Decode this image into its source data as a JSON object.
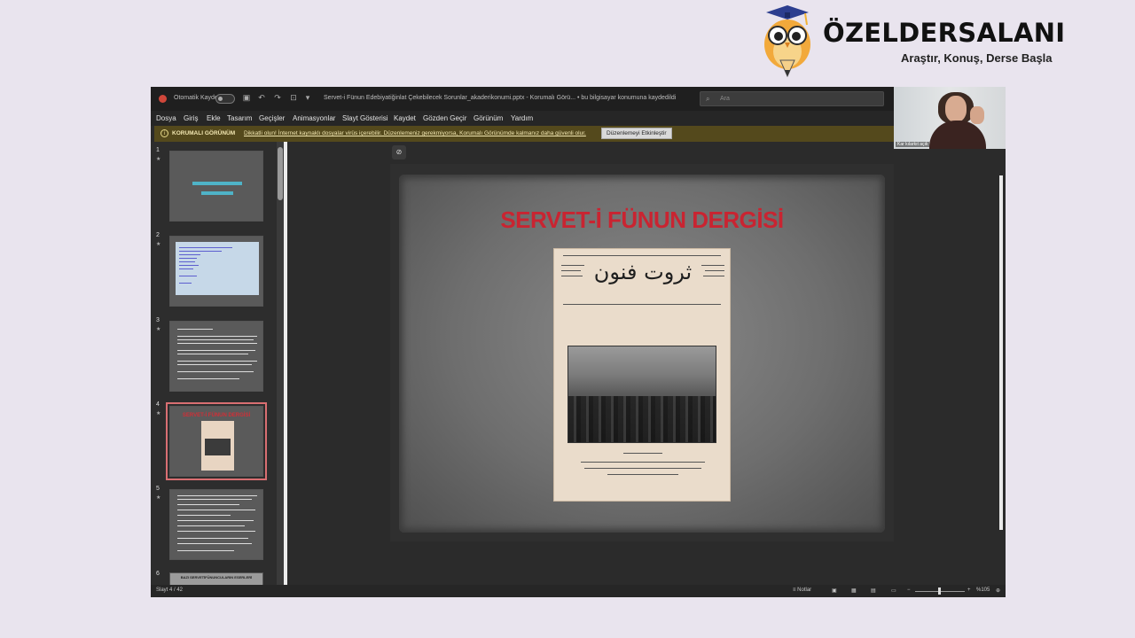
{
  "brand": {
    "name": "ÖZELDERSALANI",
    "tagline": "Araştır, Konuş, Derse Başla"
  },
  "titlebar": {
    "autosave_label": "Otomatik Kaydet",
    "document_title": "Servet-i Fünun Edebiyatiğinlat Çekebilecek Sorunlar_akaderikonumi.pptx  -  Korumalı Görü...  •  bu bilgisayar konumuna kaydedildi",
    "search_placeholder": "Ara"
  },
  "menu": [
    "Dosya",
    "Giriş",
    "Ekle",
    "Tasarım",
    "Geçişler",
    "Animasyonlar",
    "Slayt Gösterisi",
    "Kaydet",
    "Gözden Geçir",
    "Görünüm",
    "Yardım"
  ],
  "protected_view": {
    "title": "KORUMALI GÖRÜNÜM",
    "message": "Dikkatli olun! İnternet kaynaklı dosyalar virüs içerebilir. Düzenlemeniz gerekmiyorsa, Korumalı Görünümde kalmanız daha güvenli olur.",
    "button": "Düzenlemeyi Etkinleştir"
  },
  "thumbnails": [
    {
      "number": "1"
    },
    {
      "number": "2"
    },
    {
      "number": "3"
    },
    {
      "number": "4",
      "title": "SERVET-İ FÜNUN DERGİSİ"
    },
    {
      "number": "5"
    },
    {
      "number": "6",
      "title": "BAZI SERVETİFÜNUNCULARIN ESERLERİ"
    }
  ],
  "slide": {
    "title": "SERVET-İ FÜNUN DERGİSİ",
    "masthead": "ثروت فنون"
  },
  "webcam": {
    "participant": "Kar kılarkıt açık"
  },
  "status": {
    "slide_counter": "Slayt 4 / 42",
    "notes": "Notlar",
    "zoom": "%105"
  },
  "colors": {
    "accent_red": "#c92431",
    "protected_bar": "#54491c",
    "selection": "#d96f72"
  }
}
